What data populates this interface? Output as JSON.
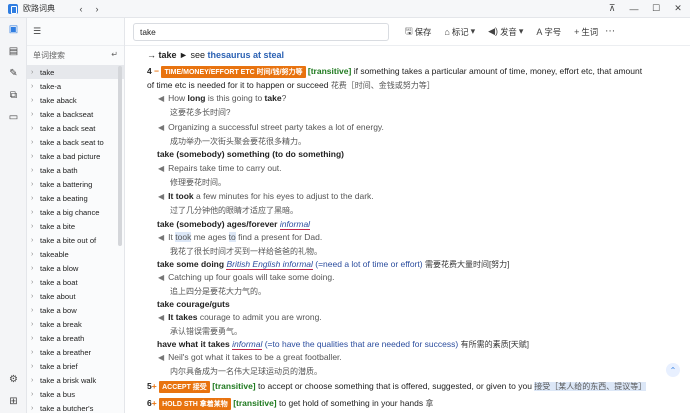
{
  "app": {
    "title": "欧路词典"
  },
  "search": {
    "value": "take"
  },
  "toolbar": {
    "save_label": "保存",
    "mark_label": "标记",
    "speak_label": "发音",
    "font_label": "字号",
    "vocab_label": "生词"
  },
  "sidebar": {
    "title": "单词搜索",
    "items": [
      "take",
      "take-a",
      "take aback",
      "take a backseat",
      "take a back seat",
      "take a back seat to",
      "take a bad picture",
      "take a bath",
      "take a battering",
      "take a beating",
      "take a big chance",
      "take a bite",
      "take a bite out of",
      "takeable",
      "take a blow",
      "take a boat",
      "take about",
      "take a bow",
      "take a break",
      "take a breath",
      "take a breather",
      "take a brief",
      "take a brisk walk",
      "take a bus",
      "take a butcher's"
    ]
  },
  "entry": {
    "see_line": {
      "text1": "→ take ► ",
      "see": "see ",
      "target": "thesaurus at steal"
    },
    "sense4": {
      "num": "4",
      "tag": "TIME/MONEY/EFFORT ETC 时间/钱/努力等",
      "gram": "[transitive]",
      "def1": " if something takes a particular amount of time, money, effort etc, that amount",
      "def2": "of time etc is needed for it to happen or succeed ",
      "def_zh": "花费［时间、金钱或努力等］",
      "ex1_en_a": "How ",
      "ex1_en_b": "long",
      "ex1_en_c": " is this going to ",
      "ex1_en_d": "take",
      "ex1_en_e": "?",
      "ex1_zh": "这要花多长时间?",
      "ex2_en": "Organizing a successful street party takes a lot of energy.",
      "ex2_zh": "成功举办一次街头聚会要花很多精力。",
      "p1": "take (somebody) something (to do something)",
      "ex3_en": "Repairs take time to carry out.",
      "ex3_zh": "修理要花时间。",
      "ex4_en_a": "It took",
      "ex4_en_b": " a few minutes for his eyes to adjust to the dark.",
      "ex4_zh": "过了几分钟他的眼睛才适应了黑暗。",
      "p2": "take (somebody) ages/forever ",
      "p2_label": "informal",
      "ex5_en_a": "It ",
      "ex5_en_b": "took",
      "ex5_en_c": " me ages ",
      "ex5_en_d": "to",
      "ex5_en_e": " find a present for Dad.",
      "ex5_zh": "我花了很长时间才买到一样给爸爸的礼物。",
      "p3": "take some doing ",
      "p3_label": "British English informal",
      "p3_def": " (=need a lot of time or effort) ",
      "p3_zh": "需要花费大量时间[努力]",
      "ex6_en": "Catching up four goals will take some doing.",
      "ex6_zh": "追上四分是要花大力气的。",
      "p4": "take courage/guts",
      "ex7_en_a": "It takes",
      "ex7_en_b": " courage to admit you are wrong.",
      "ex7_zh": "承认错误需要勇气。",
      "p5": "have what it takes ",
      "p5_label": "informal",
      "p5_def": " (=to have the qualities that are needed for success) ",
      "p5_zh": "有所需的素质[天赋]",
      "ex8_en": "Neil's got what it takes to be a great footballer.",
      "ex8_zh": "内尔具备成为一名伟大足球运动员的潜质。"
    },
    "sense5": {
      "num": "5",
      "tag": "ACCEPT 接受",
      "gram": "[transitive]",
      "def": " to accept or choose something that is offered, suggested, or given to you ",
      "zh": "接受［某人给的东西、提议等］"
    },
    "sense6": {
      "num": "6",
      "tag": "HOLD STH 拿着某物",
      "gram": "[transitive]",
      "def": " to get hold of something in your hands ",
      "zh": "拿"
    }
  }
}
